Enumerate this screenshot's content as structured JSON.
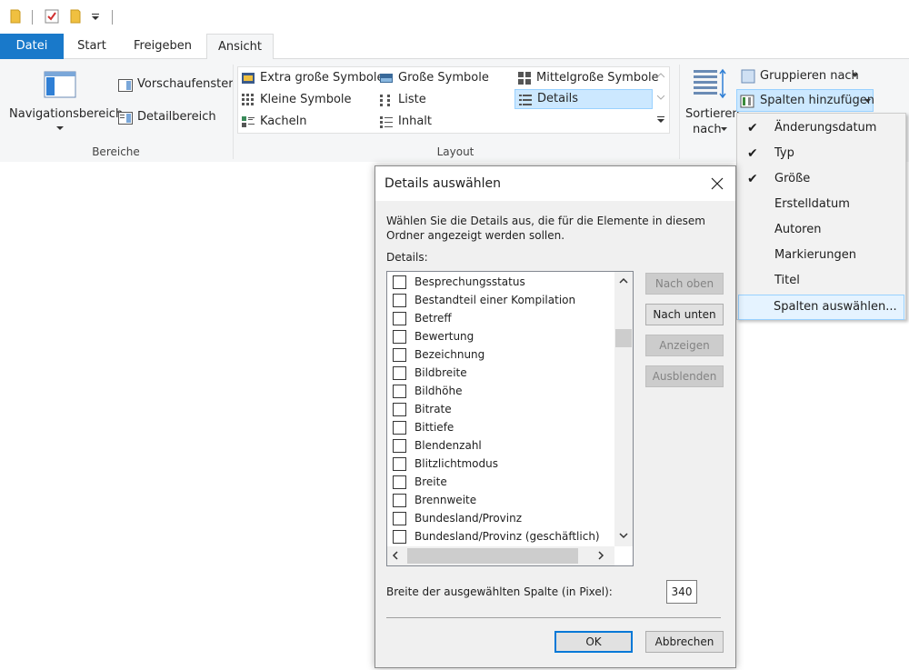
{
  "quick_access": {
    "icons": [
      "folder-icon",
      "properties-check-icon",
      "new-folder-icon",
      "customize-dropdown-icon"
    ]
  },
  "tabs": [
    {
      "label": "Datei"
    },
    {
      "label": "Start"
    },
    {
      "label": "Freigeben"
    },
    {
      "label": "Ansicht"
    }
  ],
  "ribbon": {
    "bereiche": {
      "navigation_label": "Navigationsbereich",
      "preview_label": "Vorschaufenster",
      "details_label": "Detailbereich",
      "group_label": "Bereiche"
    },
    "layout": {
      "items": [
        {
          "label": "Extra große Symbole"
        },
        {
          "label": "Große Symbole"
        },
        {
          "label": "Mittelgroße Symbole"
        },
        {
          "label": "Kleine Symbole"
        },
        {
          "label": "Liste"
        },
        {
          "label": "Details"
        },
        {
          "label": "Kacheln"
        },
        {
          "label": "Inhalt"
        }
      ],
      "selected": "Details",
      "group_label": "Layout"
    },
    "current_view": {
      "sort_label_1": "Sortieren",
      "sort_label_2": "nach",
      "group_by_label": "Gruppieren nach",
      "add_columns_label": "Spalten hinzufügen"
    }
  },
  "columns_menu": {
    "items": [
      {
        "label": "Änderungsdatum",
        "checked": "✔"
      },
      {
        "label": "Typ",
        "checked": "✔"
      },
      {
        "label": "Größe",
        "checked": "✔"
      },
      {
        "label": "Erstelldatum",
        "checked": ""
      },
      {
        "label": "Autoren",
        "checked": ""
      },
      {
        "label": "Markierungen",
        "checked": ""
      },
      {
        "label": "Titel",
        "checked": ""
      },
      {
        "label": "Spalten auswählen...",
        "checked": ""
      }
    ]
  },
  "dialog": {
    "title": "Details auswählen",
    "description": "Wählen Sie die Details aus, die für die Elemente in diesem Ordner angezeigt werden sollen.",
    "details_label": "Details:",
    "items": [
      "Besprechungsstatus",
      "Bestandteil einer Kompilation",
      "Betreff",
      "Bewertung",
      "Bezeichnung",
      "Bildbreite",
      "Bildhöhe",
      "Bitrate",
      "Bittiefe",
      "Blendenzahl",
      "Blitzlichtmodus",
      "Breite",
      "Brennweite",
      "Bundesland/Provinz",
      "Bundesland/Provinz (geschäftlich)"
    ],
    "buttons": {
      "up": "Nach oben",
      "down": "Nach unten",
      "show": "Anzeigen",
      "hide": "Ausblenden",
      "ok": "OK",
      "cancel": "Abbrechen"
    },
    "width_label": "Breite der ausgewählten Spalte (in Pixel):",
    "width_value": "340"
  },
  "colors": {
    "accent": "#1979ca",
    "selection": "#cce8ff",
    "selection_border": "#99d1ff"
  }
}
